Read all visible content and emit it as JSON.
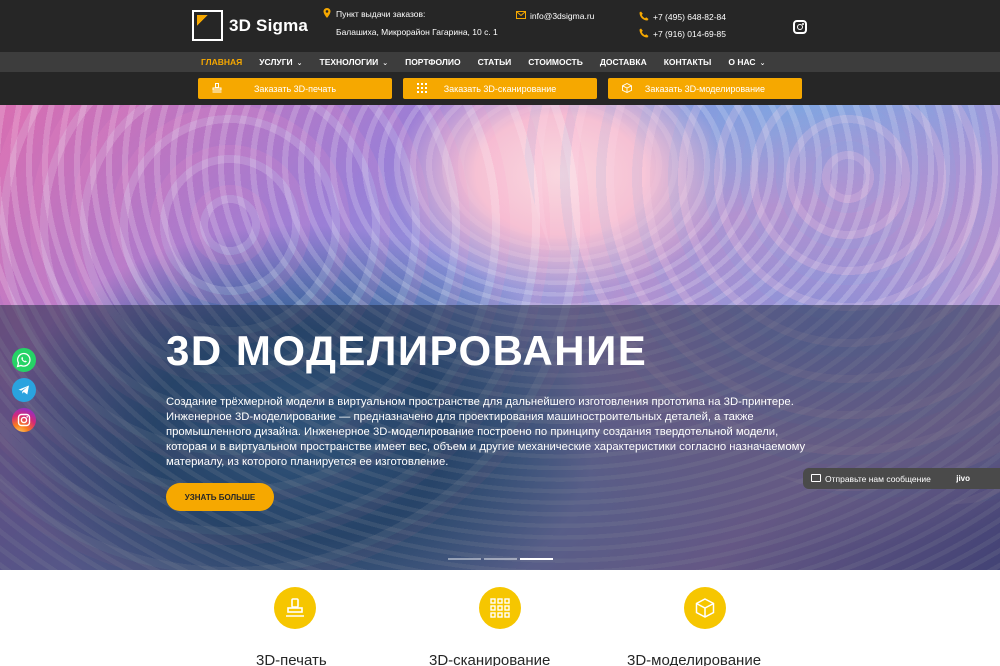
{
  "brand": {
    "name": "3D Sigma"
  },
  "header": {
    "pickup_title": "Пункт выдачи заказов:",
    "pickup_address": "Балашиха, Микрорайон Гагарина, 10 с. 1",
    "email": "info@3dsigma.ru",
    "phone1": "+7 (495) 648-82-84",
    "phone2": "+7 (916) 014-69-85"
  },
  "nav": {
    "items": [
      {
        "label": "Главная",
        "active": true
      },
      {
        "label": "Услуги",
        "dropdown": true
      },
      {
        "label": "Технологии",
        "dropdown": true
      },
      {
        "label": "Портфолио"
      },
      {
        "label": "Статьи"
      },
      {
        "label": "Стоимость"
      },
      {
        "label": "Доставка"
      },
      {
        "label": "Контакты"
      },
      {
        "label": "О нас",
        "dropdown": true
      }
    ],
    "caret": "⌄"
  },
  "order_buttons": [
    {
      "label": "Заказать 3D-печать"
    },
    {
      "label": "Заказать 3D-сканирование"
    },
    {
      "label": "Заказать 3D-моделирование"
    }
  ],
  "hero": {
    "title": "3D МОДЕЛИРОВАНИЕ",
    "text": "Создание трёхмерной модели в виртуальном пространстве для дальнейшего изготовления прототипа на 3D-принтере. Инженерное 3D-моделирование — предназначено для проектирования машиностроительных деталей, а также промышленного дизайна. Инженерное 3D-моделирование построено по принципу создания твердотельной модели, которая и в виртуальном пространстве имеет вес, объем и другие механические характеристики согласно назначаемому материалу, из которого планируется ее изготовление.",
    "button": "Узнать больше",
    "slides": 3,
    "active_slide": 3
  },
  "chat": {
    "label": "Отправьте нам сообщение",
    "brand": "jivo"
  },
  "features": [
    {
      "label": "3D-печать",
      "icon": "stamp-icon"
    },
    {
      "label": "3D-сканирование",
      "icon": "grid-scan-icon"
    },
    {
      "label": "3D-моделирование",
      "icon": "cube-icon"
    }
  ],
  "colors": {
    "accent": "#f6a800",
    "dark": "#262626",
    "nav": "#3d3d3d",
    "feature_circle": "#f6c600"
  }
}
